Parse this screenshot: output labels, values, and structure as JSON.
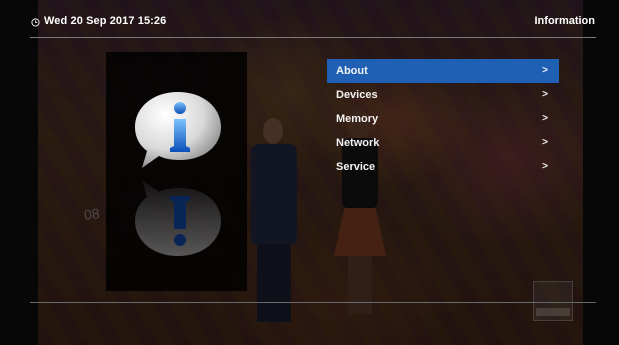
{
  "header": {
    "datetime": "Wed 20 Sep 2017  15:26",
    "title": "Information",
    "clock_icon": "clock-icon"
  },
  "menu": {
    "selected_index": 0,
    "highlight_color": "#1f5fb4",
    "items": [
      {
        "label": "About",
        "chevron": ">"
      },
      {
        "label": "Devices",
        "chevron": ">"
      },
      {
        "label": "Memory",
        "chevron": ">"
      },
      {
        "label": "Network",
        "chevron": ">"
      },
      {
        "label": "Service",
        "chevron": ">"
      }
    ]
  },
  "info_panel": {
    "icon": "info-bubble-icon",
    "reflection_icon": "info-bubble-reflection-icon"
  }
}
